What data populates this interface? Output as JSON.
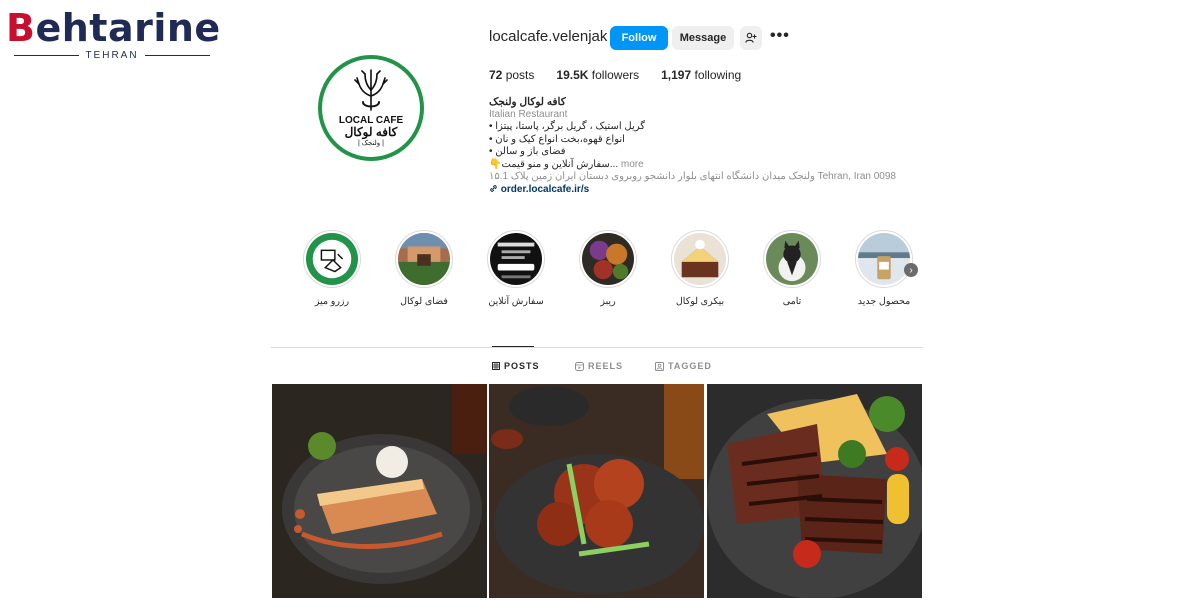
{
  "watermark": {
    "brand_b": "B",
    "brand_rest": "ehtarine",
    "city": "TEHRAN"
  },
  "avatar": {
    "text_en": "LOCAL CAFE",
    "text_fa": "کافه لوکال",
    "text_sub": "| ولنجک |"
  },
  "profile": {
    "username": "localcafe.velenjak",
    "follow_label": "Follow",
    "message_label": "Message",
    "add_user_icon": "person-plus-icon",
    "more_label": "•••"
  },
  "stats": {
    "posts_count": "72",
    "posts_label": "posts",
    "followers_count": "19.5K",
    "followers_label": "followers",
    "following_count": "1,197",
    "following_label": "following"
  },
  "bio": {
    "name": "کافه لوکال ولنجک",
    "category": "Italian Restaurant",
    "line1": "• گریل استیک ، گریل برگر، پاستا، پیتزا",
    "line2": "• انواع قهوه،بخت انواع کیک و نان",
    "line3": "• فضای باز و سالن",
    "line4": "👇سفارش آنلاین و منو قیمت...",
    "more": "more",
    "address": "ولنجک میدان دانشگاه انتهای بلوار دانشجو روبروی دبستان ایران زمین پلاک ۱۵.1 Tehran, Iran 0098",
    "link": "order.localcafe.ir/s"
  },
  "highlights": [
    {
      "label": "رزرو میز"
    },
    {
      "label": "فضای لوکال"
    },
    {
      "label": "سفارش آنلاین"
    },
    {
      "label": "ریبز"
    },
    {
      "label": "بیکری لوکال"
    },
    {
      "label": "تامی"
    },
    {
      "label": "محصول جدید"
    }
  ],
  "tabs": {
    "posts": "POSTS",
    "reels": "REELS",
    "tagged": "TAGGED"
  },
  "colors": {
    "accent": "#0095f6",
    "avatar_ring": "#21944a",
    "brand_red": "#c8102e",
    "brand_navy": "#1f2a55"
  }
}
